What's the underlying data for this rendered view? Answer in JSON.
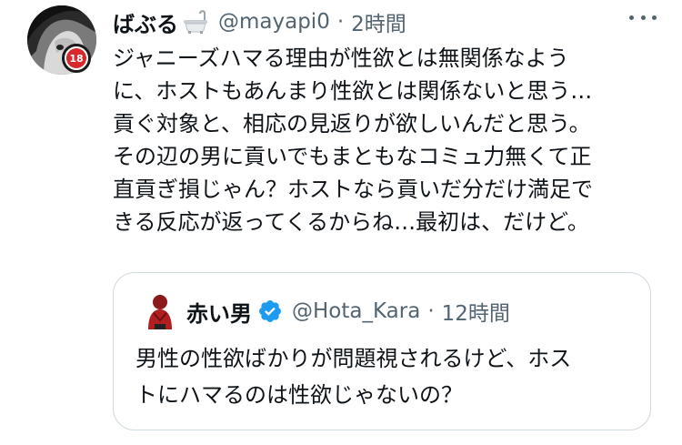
{
  "tweet": {
    "display_name": "ばぶる",
    "handle": "@mayapi0",
    "separator": "·",
    "time": "2時間",
    "badge": "18",
    "text_lines": [
      "ジャニーズハマる理由が性欲とは無関係なよう",
      "に、ホストもあんまり性欲とは関係ないと思う…",
      "貢ぐ対象と、相応の見返りが欲しいんだと思う。",
      "その辺の男に貢いでもまともなコミュ力無くて正",
      "直貢ぎ損じゃん？ホストなら貢いだ分だけ満足で",
      "きる反応が返ってくるからね…最初は、だけど。"
    ]
  },
  "quote": {
    "display_name": "赤い男",
    "handle": "@Hota_Kara",
    "separator": "·",
    "time": "12時間",
    "text_lines": [
      "男性の性欲ばかりが問題視されるけど、ホス",
      "トにハマるのは性欲じゃないの？"
    ]
  },
  "colors": {
    "verified": "#1d9bf0",
    "secondary_text": "#536471",
    "border": "#cfd9de",
    "badge_red": "#d7282f"
  },
  "icons": {
    "display_name_emoji": "bathtub-icon",
    "more": "more-icon",
    "verified": "verified-badge-icon"
  }
}
